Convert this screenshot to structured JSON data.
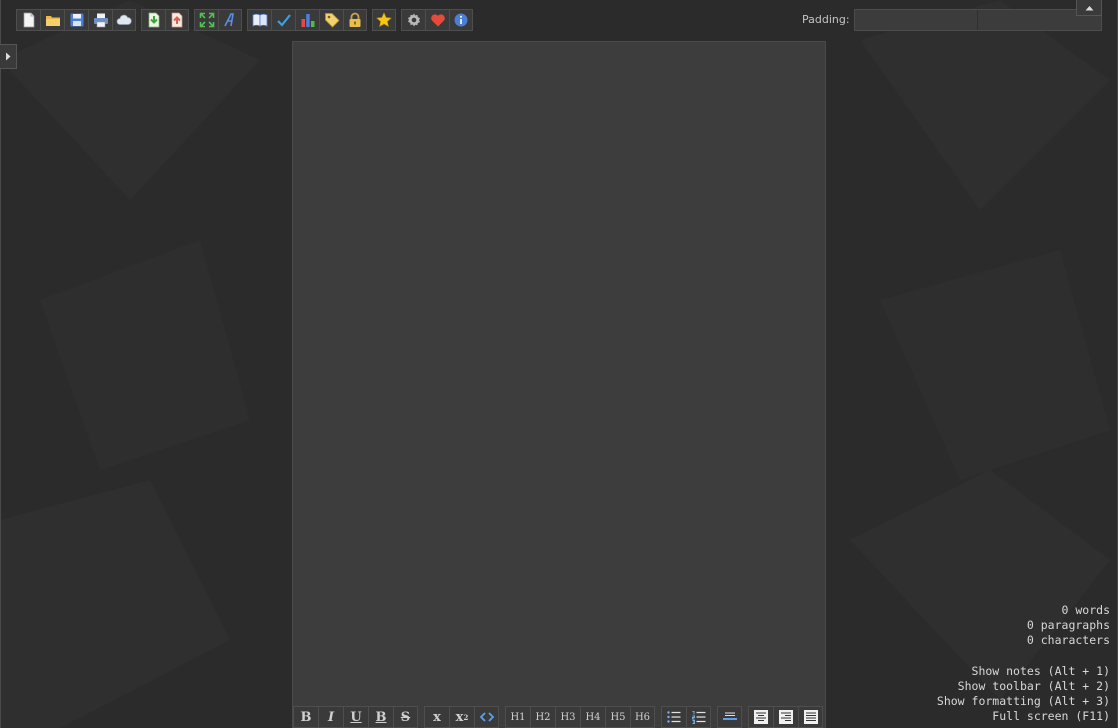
{
  "toolbar": {
    "groups": [
      [
        {
          "name": "new-document-icon",
          "title": "New"
        },
        {
          "name": "open-folder-icon",
          "title": "Open"
        },
        {
          "name": "save-icon",
          "title": "Save"
        },
        {
          "name": "print-icon",
          "title": "Print"
        },
        {
          "name": "cloud-icon",
          "title": "Cloud"
        }
      ],
      [
        {
          "name": "import-icon",
          "title": "Import"
        },
        {
          "name": "export-icon",
          "title": "Export"
        }
      ],
      [
        {
          "name": "fullscreen-icon",
          "title": "Full screen"
        },
        {
          "name": "font-icon",
          "title": "Font"
        }
      ],
      [
        {
          "name": "book-icon",
          "title": "Notes"
        },
        {
          "name": "spellcheck-icon",
          "title": "Spell check"
        },
        {
          "name": "bar-chart-icon",
          "title": "Statistics"
        },
        {
          "name": "tag-icon",
          "title": "Tags"
        },
        {
          "name": "lock-icon",
          "title": "Lock"
        }
      ],
      [
        {
          "name": "star-icon",
          "title": "Favorites"
        }
      ],
      [
        {
          "name": "gear-icon",
          "title": "Settings"
        },
        {
          "name": "heart-icon",
          "title": "Support"
        },
        {
          "name": "info-icon",
          "title": "About"
        }
      ]
    ]
  },
  "padding": {
    "label": "Padding:",
    "value": ""
  },
  "format_bar": {
    "style": {
      "bold": "B",
      "italic": "I",
      "underline": "U",
      "bold2": "B",
      "strike": "S"
    },
    "script": {
      "sub": "x",
      "sup": "x",
      "sup_mark": "2"
    },
    "headings": [
      "H1",
      "H2",
      "H3",
      "H4",
      "H5",
      "H6"
    ]
  },
  "stats": {
    "words": "0 words",
    "paragraphs": "0 paragraphs",
    "characters": "0 characters"
  },
  "shortcuts": {
    "notes": "Show notes (Alt + 1)",
    "toolbar": "Show toolbar (Alt + 2)",
    "formatting": "Show formatting (Alt + 3)",
    "fullscreen": "Full screen (F11)"
  },
  "colors": {
    "background": "#2b2b2b",
    "editor": "#3d3d3d",
    "button": "#3a3a3a",
    "text": "#d8d8d8"
  }
}
